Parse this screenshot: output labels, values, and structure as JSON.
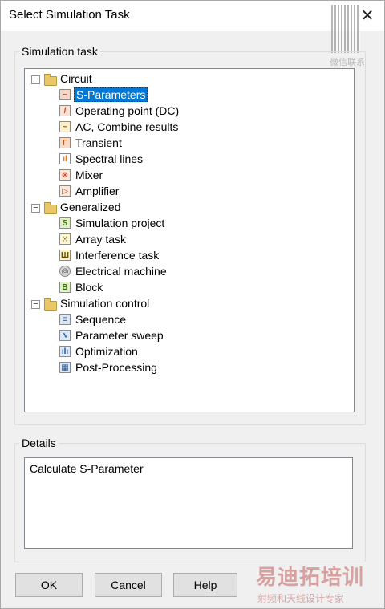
{
  "window": {
    "title": "Select Simulation Task",
    "close_glyph": "✕"
  },
  "simulation_group": {
    "label": "Simulation task"
  },
  "tree": [
    {
      "label": "Circuit",
      "icon": "folder-icon",
      "expanded": true,
      "level": 0,
      "children": [
        {
          "label": "S-Parameters",
          "icon": "sparameters-icon",
          "selected": true
        },
        {
          "label": "Operating point (DC)",
          "icon": "dc-icon"
        },
        {
          "label": "AC, Combine results",
          "icon": "ac-icon"
        },
        {
          "label": "Transient",
          "icon": "transient-icon"
        },
        {
          "label": "Spectral lines",
          "icon": "spectral-icon"
        },
        {
          "label": "Mixer",
          "icon": "mixer-icon"
        },
        {
          "label": "Amplifier",
          "icon": "amplifier-icon"
        }
      ]
    },
    {
      "label": "Generalized",
      "icon": "folder-icon",
      "expanded": true,
      "level": 0,
      "children": [
        {
          "label": "Simulation project",
          "icon": "s-letter-icon"
        },
        {
          "label": "Array task",
          "icon": "array-icon"
        },
        {
          "label": "Interference task",
          "icon": "interference-icon"
        },
        {
          "label": "Electrical machine",
          "icon": "machine-icon"
        },
        {
          "label": "Block",
          "icon": "b-letter-icon"
        }
      ]
    },
    {
      "label": "Simulation control",
      "icon": "folder-icon",
      "expanded": true,
      "level": 0,
      "children": [
        {
          "label": "Sequence",
          "icon": "sequence-icon"
        },
        {
          "label": "Parameter sweep",
          "icon": "sweep-icon"
        },
        {
          "label": "Optimization",
          "icon": "optimization-icon"
        },
        {
          "label": "Post-Processing",
          "icon": "postprocessing-icon"
        }
      ]
    }
  ],
  "details_group": {
    "label": "Details",
    "text": "Calculate S-Parameter"
  },
  "buttons": {
    "ok": "OK",
    "cancel": "Cancel",
    "help": "Help"
  },
  "watermarks": {
    "top_right": "微信联系",
    "bottom_right": "易迪拓培训",
    "bottom_right_sub": "射频和天线设计专家"
  },
  "colors": {
    "selection": "#0078d7",
    "background": "#f0f0f0"
  }
}
